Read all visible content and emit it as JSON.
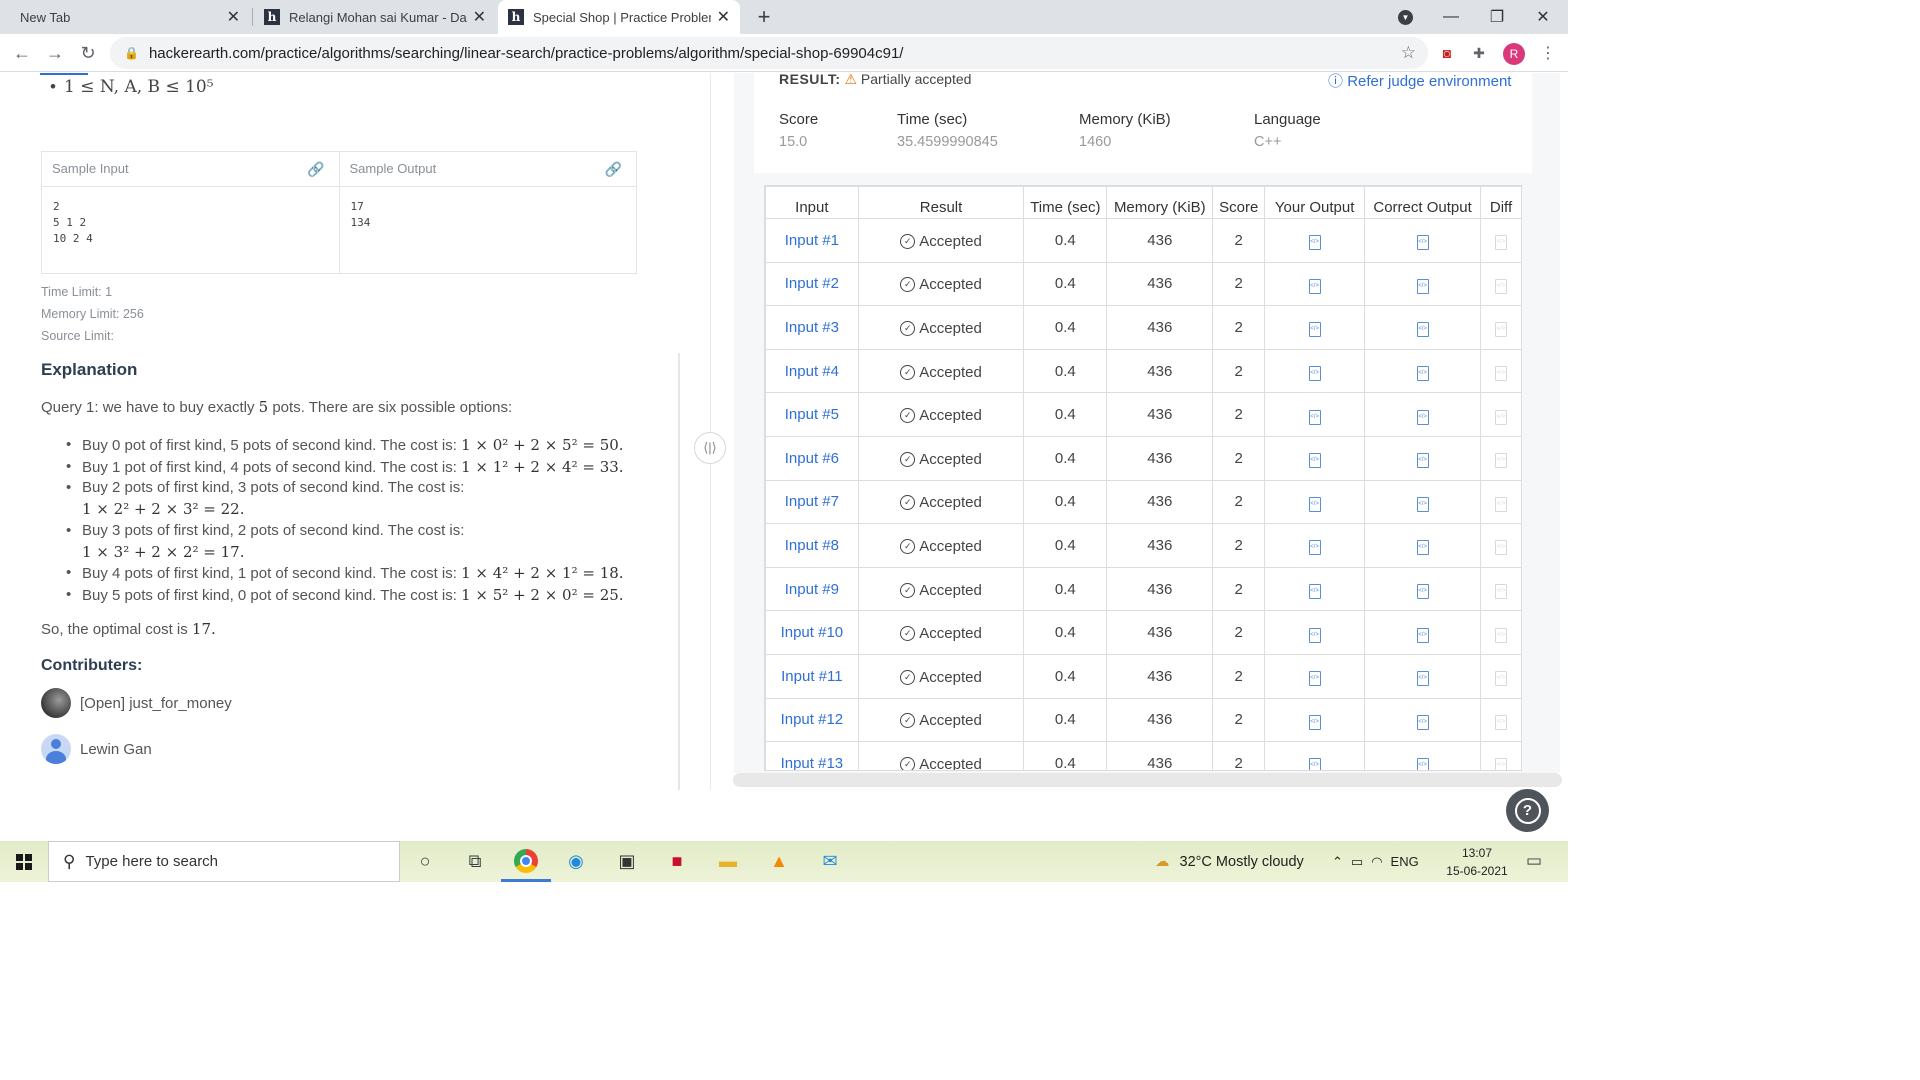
{
  "browser": {
    "tabs": [
      {
        "title": "New Tab",
        "favicon": ""
      },
      {
        "title": "Relangi Mohan sai Kumar - Data",
        "favicon": "h"
      },
      {
        "title": "Special Shop | Practice Problems",
        "favicon": "h"
      }
    ],
    "url": "hackerearth.com/practice/algorithms/searching/linear-search/practice-problems/algorithm/special-shop-69904c91/",
    "profile_initial": "R"
  },
  "problem": {
    "constraint": "1 ≤ N, A, B ≤ 10⁵",
    "sample_input_label": "Sample Input",
    "sample_output_label": "Sample Output",
    "sample_input": "2\n5 1 2\n10 2 4",
    "sample_output": "17\n134",
    "time_limit": "Time Limit: 1",
    "memory_limit": "Memory Limit: 256",
    "source_limit": "Source Limit:",
    "explanation_heading": "Explanation",
    "query_text_1": "Query 1: we have to buy exactly ",
    "query_num": "5",
    "query_text_2": " pots. There are six possible options:",
    "bullets": [
      {
        "text": "Buy 0 pot of first kind, 5 pots of second kind. The cost is: ",
        "math": "1 × 0² + 2 × 5² = 50."
      },
      {
        "text": "Buy 1 pot of first kind, 4 pots of second kind. The cost is: ",
        "math": "1 × 1² + 2 × 4² = 33."
      },
      {
        "text": "Buy 2 pots of first kind, 3 pots of second kind. The cost is:",
        "math": "1 × 2² + 2 × 3² = 22."
      },
      {
        "text": "Buy 3 pots of first kind, 2 pots of second kind. The cost is:",
        "math": "1 × 3² + 2 × 2² = 17."
      },
      {
        "text": "Buy 4 pots of first kind, 1 pot of second kind. The cost is: ",
        "math": "1 × 4² + 2 × 1² = 18."
      },
      {
        "text": "Buy 5 pots of first kind, 0 pot of second kind. The cost is: ",
        "math": "1 × 5² + 2 × 0² = 25."
      }
    ],
    "optimal_text": "So, the optimal cost is ",
    "optimal_value": "17.",
    "contributors_heading": "Contributers:",
    "contributors": [
      "[Open] just_for_money",
      "Lewin Gan"
    ]
  },
  "result": {
    "label": "RESULT:",
    "status": "Partially accepted",
    "judge_link": "Refer judge environment",
    "stats": [
      {
        "label": "Score",
        "value": "15.0"
      },
      {
        "label": "Time (sec)",
        "value": "35.4599990845"
      },
      {
        "label": "Memory (KiB)",
        "value": "1460"
      },
      {
        "label": "Language",
        "value": "C++"
      }
    ],
    "columns": [
      "Input",
      "Result",
      "Time (sec)",
      "Memory (KiB)",
      "Score",
      "Your Output",
      "Correct Output",
      "Diff"
    ],
    "rows": [
      {
        "input": "Input #1",
        "result": "Accepted",
        "time": "0.4",
        "memory": "436",
        "score": "2"
      },
      {
        "input": "Input #2",
        "result": "Accepted",
        "time": "0.4",
        "memory": "436",
        "score": "2"
      },
      {
        "input": "Input #3",
        "result": "Accepted",
        "time": "0.4",
        "memory": "436",
        "score": "2"
      },
      {
        "input": "Input #4",
        "result": "Accepted",
        "time": "0.4",
        "memory": "436",
        "score": "2"
      },
      {
        "input": "Input #5",
        "result": "Accepted",
        "time": "0.4",
        "memory": "436",
        "score": "2"
      },
      {
        "input": "Input #6",
        "result": "Accepted",
        "time": "0.4",
        "memory": "436",
        "score": "2"
      },
      {
        "input": "Input #7",
        "result": "Accepted",
        "time": "0.4",
        "memory": "436",
        "score": "2"
      },
      {
        "input": "Input #8",
        "result": "Accepted",
        "time": "0.4",
        "memory": "436",
        "score": "2"
      },
      {
        "input": "Input #9",
        "result": "Accepted",
        "time": "0.4",
        "memory": "436",
        "score": "2"
      },
      {
        "input": "Input #10",
        "result": "Accepted",
        "time": "0.4",
        "memory": "436",
        "score": "2"
      },
      {
        "input": "Input #11",
        "result": "Accepted",
        "time": "0.4",
        "memory": "436",
        "score": "2"
      },
      {
        "input": "Input #12",
        "result": "Accepted",
        "time": "0.4",
        "memory": "436",
        "score": "2"
      },
      {
        "input": "Input #13",
        "result": "Accepted",
        "time": "0.4",
        "memory": "436",
        "score": "2"
      }
    ]
  },
  "taskbar": {
    "search_placeholder": "Type here to search",
    "weather": "32°C  Mostly cloudy",
    "language": "ENG",
    "time": "13:07",
    "date": "15-06-2021"
  },
  "colors": {
    "accent": "#2f6fd6",
    "tab_bar": "#dee1e6",
    "profile": "#d9387a"
  }
}
